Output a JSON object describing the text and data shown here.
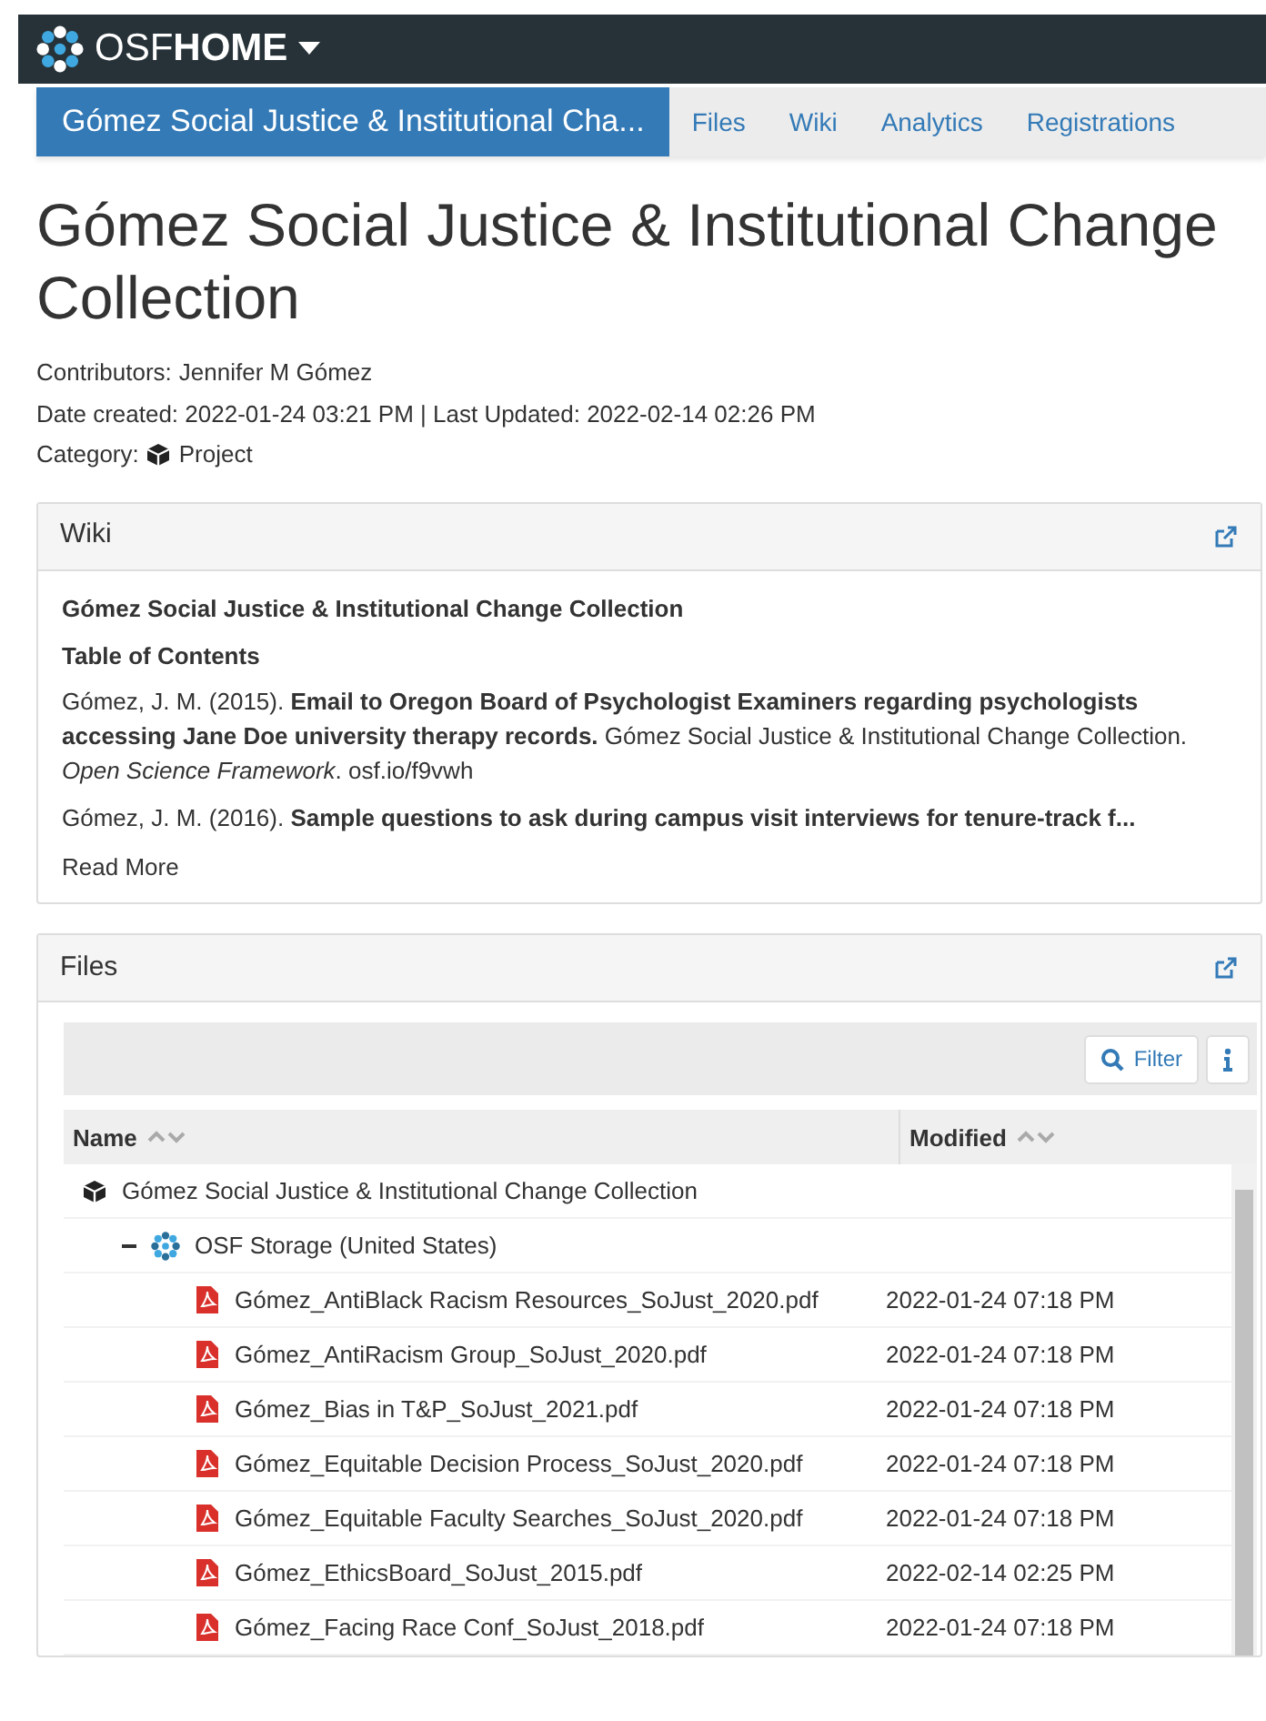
{
  "navbar": {
    "brand_light": "OSF",
    "brand_bold": "HOME"
  },
  "project_nav": {
    "title": "Gómez Social Justice & Institutional Cha...",
    "links": [
      {
        "label": "Files",
        "selected": false
      },
      {
        "label": "Wiki",
        "selected": false
      },
      {
        "label": "Analytics",
        "selected": false
      },
      {
        "label": "Registrations",
        "selected": false
      }
    ]
  },
  "title": "Gómez Social Justice & Institutional Change Collection",
  "meta": {
    "contributors_label": "Contributors:",
    "contributor": "Jennifer M Gómez",
    "dates": "Date created: 2022-01-24 03:21 PM | Last Updated: 2022-02-14 02:26 PM",
    "category_label": "Category:",
    "category": "Project"
  },
  "wiki": {
    "heading": "Wiki",
    "title": "Gómez Social Justice & Institutional Change Collection",
    "toc": "Table of Contents",
    "citations": [
      {
        "text": "Gómez, J. M. (2015). **Email to Oregon Board of Psychologist Examiners regarding psychologists accessing Jane Doe university therapy records.** Gómez Social Justice & Institutional Change Collection. *Open Science Framework*.",
        "link": "osf.io/f9vwh"
      },
      {
        "text": "Gómez, J. M. (2016). **Sample questions to ask during campus visit interviews for tenure-track f...**"
      }
    ],
    "read_more": "Read More"
  },
  "files": {
    "heading": "Files",
    "filter": "Filter",
    "columns": [
      "Name",
      "Modified"
    ],
    "tree": [
      {
        "kind": "project",
        "name": "Gómez Social Justice & Institutional Change Collection",
        "children": [
          {
            "kind": "storage",
            "name": "OSF Storage (United States)",
            "expanded": true,
            "children": [
              {
                "kind": "pdf",
                "name": "Gómez_AntiBlack Racism Resources_SoJust_2020.pdf",
                "modified": "2022-01-24 07:18 PM"
              },
              {
                "kind": "pdf",
                "name": "Gómez_AntiRacism Group_SoJust_2020.pdf",
                "modified": "2022-01-24 07:18 PM"
              },
              {
                "kind": "pdf",
                "name": "Gómez_Bias in T&P_SoJust_2021.pdf",
                "modified": "2022-01-24 07:18 PM"
              },
              {
                "kind": "pdf",
                "name": "Gómez_Equitable Decision Process_SoJust_2020.pdf",
                "modified": "2022-01-24 07:18 PM"
              },
              {
                "kind": "pdf",
                "name": "Gómez_Equitable Faculty Searches_SoJust_2020.pdf",
                "modified": "2022-01-24 07:18 PM"
              },
              {
                "kind": "pdf",
                "name": "Gómez_EthicsBoard_SoJust_2015.pdf",
                "modified": "2022-02-14 02:25 PM"
              },
              {
                "kind": "pdf",
                "name": "Gómez_Facing Race Conf_SoJust_2018.pdf",
                "modified": "2022-01-24 07:18 PM"
              }
            ]
          }
        ]
      }
    ]
  }
}
